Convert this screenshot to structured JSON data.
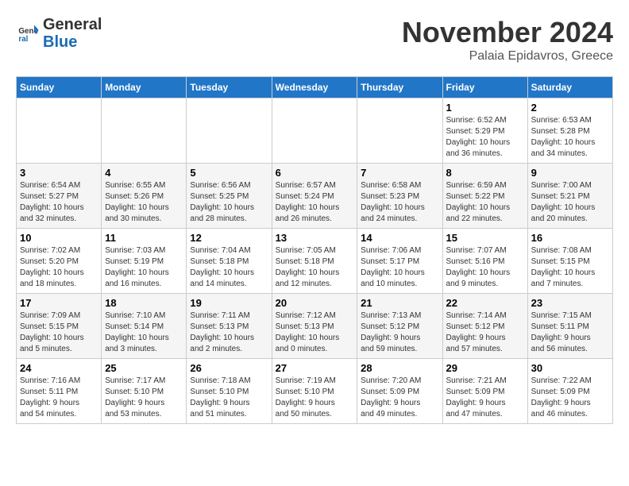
{
  "header": {
    "logo_general": "General",
    "logo_blue": "Blue",
    "month_title": "November 2024",
    "location": "Palaia Epidavros, Greece"
  },
  "days_of_week": [
    "Sunday",
    "Monday",
    "Tuesday",
    "Wednesday",
    "Thursday",
    "Friday",
    "Saturday"
  ],
  "weeks": [
    [
      {
        "day": "",
        "info": ""
      },
      {
        "day": "",
        "info": ""
      },
      {
        "day": "",
        "info": ""
      },
      {
        "day": "",
        "info": ""
      },
      {
        "day": "",
        "info": ""
      },
      {
        "day": "1",
        "info": "Sunrise: 6:52 AM\nSunset: 5:29 PM\nDaylight: 10 hours\nand 36 minutes."
      },
      {
        "day": "2",
        "info": "Sunrise: 6:53 AM\nSunset: 5:28 PM\nDaylight: 10 hours\nand 34 minutes."
      }
    ],
    [
      {
        "day": "3",
        "info": "Sunrise: 6:54 AM\nSunset: 5:27 PM\nDaylight: 10 hours\nand 32 minutes."
      },
      {
        "day": "4",
        "info": "Sunrise: 6:55 AM\nSunset: 5:26 PM\nDaylight: 10 hours\nand 30 minutes."
      },
      {
        "day": "5",
        "info": "Sunrise: 6:56 AM\nSunset: 5:25 PM\nDaylight: 10 hours\nand 28 minutes."
      },
      {
        "day": "6",
        "info": "Sunrise: 6:57 AM\nSunset: 5:24 PM\nDaylight: 10 hours\nand 26 minutes."
      },
      {
        "day": "7",
        "info": "Sunrise: 6:58 AM\nSunset: 5:23 PM\nDaylight: 10 hours\nand 24 minutes."
      },
      {
        "day": "8",
        "info": "Sunrise: 6:59 AM\nSunset: 5:22 PM\nDaylight: 10 hours\nand 22 minutes."
      },
      {
        "day": "9",
        "info": "Sunrise: 7:00 AM\nSunset: 5:21 PM\nDaylight: 10 hours\nand 20 minutes."
      }
    ],
    [
      {
        "day": "10",
        "info": "Sunrise: 7:02 AM\nSunset: 5:20 PM\nDaylight: 10 hours\nand 18 minutes."
      },
      {
        "day": "11",
        "info": "Sunrise: 7:03 AM\nSunset: 5:19 PM\nDaylight: 10 hours\nand 16 minutes."
      },
      {
        "day": "12",
        "info": "Sunrise: 7:04 AM\nSunset: 5:18 PM\nDaylight: 10 hours\nand 14 minutes."
      },
      {
        "day": "13",
        "info": "Sunrise: 7:05 AM\nSunset: 5:18 PM\nDaylight: 10 hours\nand 12 minutes."
      },
      {
        "day": "14",
        "info": "Sunrise: 7:06 AM\nSunset: 5:17 PM\nDaylight: 10 hours\nand 10 minutes."
      },
      {
        "day": "15",
        "info": "Sunrise: 7:07 AM\nSunset: 5:16 PM\nDaylight: 10 hours\nand 9 minutes."
      },
      {
        "day": "16",
        "info": "Sunrise: 7:08 AM\nSunset: 5:15 PM\nDaylight: 10 hours\nand 7 minutes."
      }
    ],
    [
      {
        "day": "17",
        "info": "Sunrise: 7:09 AM\nSunset: 5:15 PM\nDaylight: 10 hours\nand 5 minutes."
      },
      {
        "day": "18",
        "info": "Sunrise: 7:10 AM\nSunset: 5:14 PM\nDaylight: 10 hours\nand 3 minutes."
      },
      {
        "day": "19",
        "info": "Sunrise: 7:11 AM\nSunset: 5:13 PM\nDaylight: 10 hours\nand 2 minutes."
      },
      {
        "day": "20",
        "info": "Sunrise: 7:12 AM\nSunset: 5:13 PM\nDaylight: 10 hours\nand 0 minutes."
      },
      {
        "day": "21",
        "info": "Sunrise: 7:13 AM\nSunset: 5:12 PM\nDaylight: 9 hours\nand 59 minutes."
      },
      {
        "day": "22",
        "info": "Sunrise: 7:14 AM\nSunset: 5:12 PM\nDaylight: 9 hours\nand 57 minutes."
      },
      {
        "day": "23",
        "info": "Sunrise: 7:15 AM\nSunset: 5:11 PM\nDaylight: 9 hours\nand 56 minutes."
      }
    ],
    [
      {
        "day": "24",
        "info": "Sunrise: 7:16 AM\nSunset: 5:11 PM\nDaylight: 9 hours\nand 54 minutes."
      },
      {
        "day": "25",
        "info": "Sunrise: 7:17 AM\nSunset: 5:10 PM\nDaylight: 9 hours\nand 53 minutes."
      },
      {
        "day": "26",
        "info": "Sunrise: 7:18 AM\nSunset: 5:10 PM\nDaylight: 9 hours\nand 51 minutes."
      },
      {
        "day": "27",
        "info": "Sunrise: 7:19 AM\nSunset: 5:10 PM\nDaylight: 9 hours\nand 50 minutes."
      },
      {
        "day": "28",
        "info": "Sunrise: 7:20 AM\nSunset: 5:09 PM\nDaylight: 9 hours\nand 49 minutes."
      },
      {
        "day": "29",
        "info": "Sunrise: 7:21 AM\nSunset: 5:09 PM\nDaylight: 9 hours\nand 47 minutes."
      },
      {
        "day": "30",
        "info": "Sunrise: 7:22 AM\nSunset: 5:09 PM\nDaylight: 9 hours\nand 46 minutes."
      }
    ]
  ]
}
